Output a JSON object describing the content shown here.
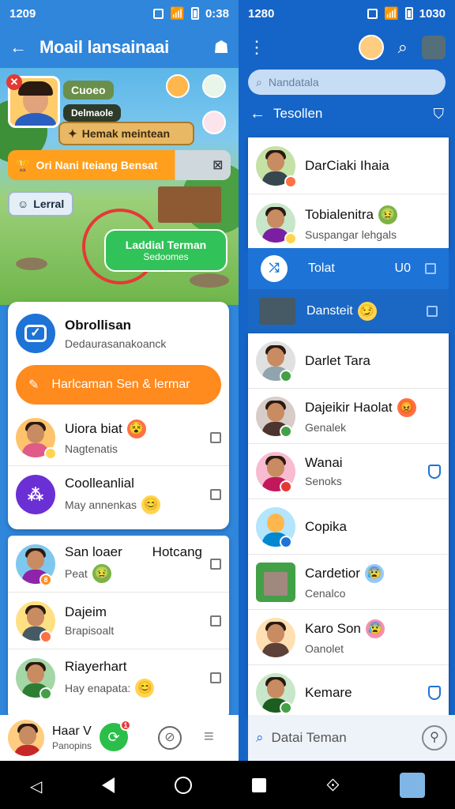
{
  "left": {
    "status": {
      "time": "1209"
    },
    "appbar": {
      "title": "Moail lansainaai"
    },
    "scene": {
      "tag_a": "Cuoeo",
      "tag_b": "Delmaole",
      "bubble_top": "Hemak meintean",
      "quest": "Ori Nani Iteiang Bensat",
      "label": "Lerral",
      "green_bubble_line1": "Laddial Terman",
      "green_bubble_line2": "Sedoomes"
    },
    "header_card": {
      "title": "Obrollisan",
      "subtitle": "Dedaurasanakoanck",
      "cta": "Harlcaman Sen & lermar"
    },
    "list_top": [
      {
        "name": "Uiora biat",
        "sub": "Nagtenatis",
        "emoji": "😵",
        "sub_emoji": ""
      },
      {
        "name": "Coolleanlial",
        "sub": "May annenkas",
        "emoji": "",
        "sub_emoji": "😊"
      }
    ],
    "list_bottom": [
      {
        "name": "San loaer",
        "extra": "Hotcang",
        "sub": "Peat",
        "sub_emoji": "🤢"
      },
      {
        "name": "Dajeim",
        "sub": "Brapisoalt"
      },
      {
        "name": "Riayerhart",
        "sub": "Hay enapata:",
        "sub_emoji": "😊"
      }
    ],
    "bottom": {
      "name": "Haar V",
      "sub": "Panopins",
      "notif": "1"
    }
  },
  "right": {
    "status": {
      "time": "1280",
      "time2": "1030"
    },
    "search": {
      "placeholder": "Nandatala"
    },
    "subbar": {
      "title": "Tesollen"
    },
    "top_card": [
      {
        "name": "DarCiaki Ihaia",
        "sub": ""
      },
      {
        "name": "Tobialenitra",
        "sub": "Suspangar lehgals",
        "emoji": "🤢"
      }
    ],
    "highlight": [
      {
        "name": "Tolat",
        "extra": "U0"
      },
      {
        "name": "Dansteit",
        "emoji": "😏"
      }
    ],
    "list": [
      {
        "name": "Darlet Tara",
        "sub": ""
      },
      {
        "name": "Dajeikir Haolat",
        "sub": "Genalek",
        "emoji": "😡"
      },
      {
        "name": "Wanai",
        "sub": "Senoks"
      },
      {
        "name": "Copika",
        "sub": ""
      },
      {
        "name": "Cardetior",
        "sub": "Cenalco",
        "emoji": "😰"
      },
      {
        "name": "Karo Son",
        "sub": "Oanolet",
        "emoji": "😰"
      },
      {
        "name": "Kemare",
        "sub": ""
      }
    ],
    "bottom_search": {
      "placeholder": "Datai Teman"
    }
  },
  "colors": {
    "blue": "#2f86db",
    "orange": "#ff8a1d",
    "green": "#2bbf4a",
    "purple": "#6b2fd6"
  }
}
